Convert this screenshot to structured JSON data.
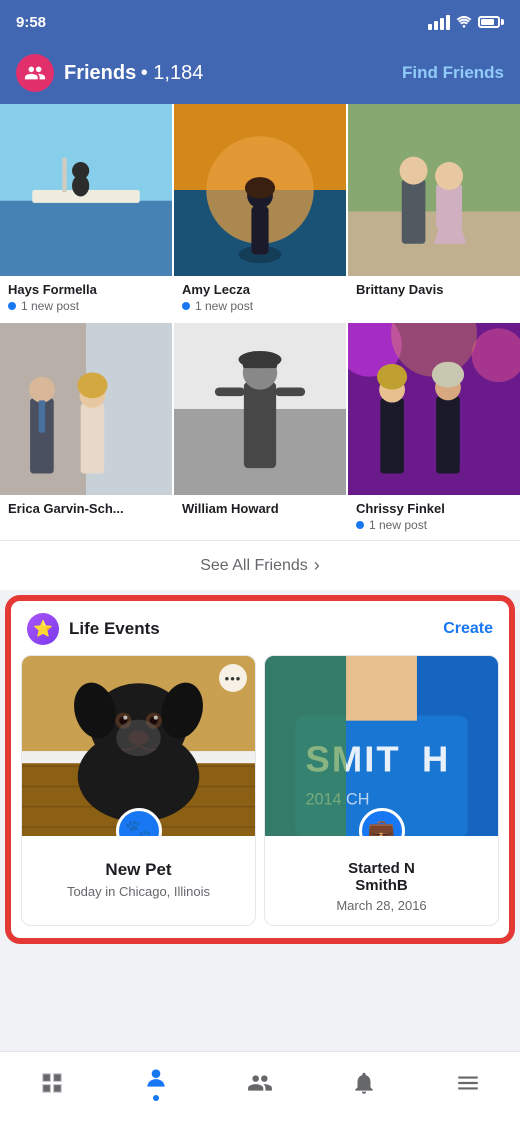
{
  "statusBar": {
    "time": "9:58"
  },
  "header": {
    "title": "Friends",
    "count": "• 1,184",
    "findFriendsLabel": "Find Friends"
  },
  "friendsGrid": [
    {
      "id": 1,
      "name": "Hays Formella",
      "hasNewPost": true,
      "newPostLabel": "1 new post",
      "photo": "1"
    },
    {
      "id": 2,
      "name": "Amy Lecza",
      "hasNewPost": true,
      "newPostLabel": "1 new post",
      "photo": "2"
    },
    {
      "id": 3,
      "name": "Brittany Davis",
      "hasNewPost": false,
      "photo": "3"
    },
    {
      "id": 4,
      "name": "Erica Garvin-Sch...",
      "hasNewPost": false,
      "photo": "4"
    },
    {
      "id": 5,
      "name": "William Howard",
      "hasNewPost": false,
      "photo": "5"
    },
    {
      "id": 6,
      "name": "Chrissy Finkel",
      "hasNewPost": true,
      "newPostLabel": "1 new post",
      "photo": "6"
    }
  ],
  "seeAll": {
    "label": "See All Friends",
    "chevron": "›"
  },
  "lifeEvents": {
    "sectionTitle": "Life Events",
    "createLabel": "Create",
    "cards": [
      {
        "id": 1,
        "title": "New Pet",
        "subtitle": "Today in Chicago, Illinois",
        "icon": "🐾",
        "moreIcon": "•••"
      },
      {
        "id": 2,
        "title": "Started N SmithB",
        "subtitle": "March 28, 2016",
        "icon": "💼"
      }
    ]
  },
  "bottomNav": [
    {
      "id": "feed",
      "icon": "feed",
      "active": false
    },
    {
      "id": "profile",
      "icon": "profile",
      "active": true,
      "hasDot": true
    },
    {
      "id": "friends",
      "icon": "friends",
      "active": false
    },
    {
      "id": "notifications",
      "icon": "bell",
      "active": false
    },
    {
      "id": "menu",
      "icon": "menu",
      "active": false
    }
  ]
}
